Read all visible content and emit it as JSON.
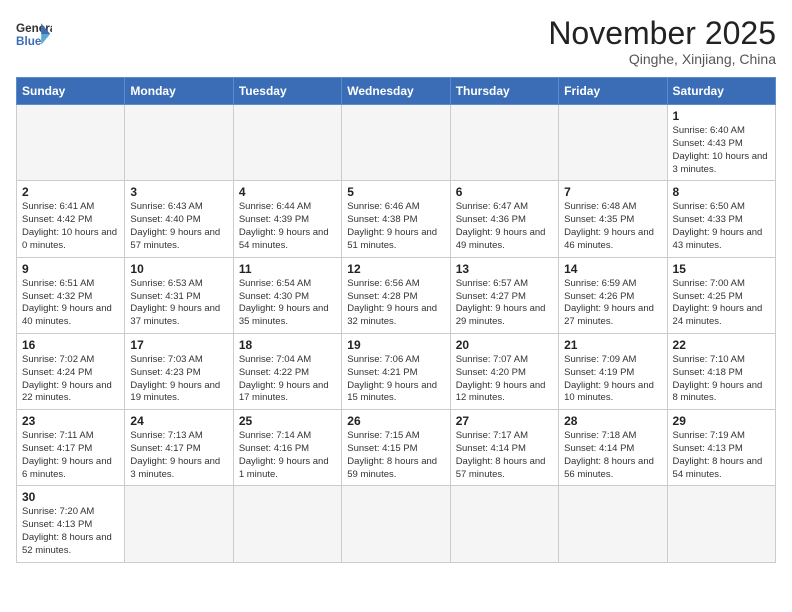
{
  "header": {
    "logo_general": "General",
    "logo_blue": "Blue",
    "title": "November 2025",
    "subtitle": "Qinghe, Xinjiang, China"
  },
  "days_of_week": [
    "Sunday",
    "Monday",
    "Tuesday",
    "Wednesday",
    "Thursday",
    "Friday",
    "Saturday"
  ],
  "weeks": [
    [
      {
        "day": "",
        "info": "",
        "empty": true
      },
      {
        "day": "",
        "info": "",
        "empty": true
      },
      {
        "day": "",
        "info": "",
        "empty": true
      },
      {
        "day": "",
        "info": "",
        "empty": true
      },
      {
        "day": "",
        "info": "",
        "empty": true
      },
      {
        "day": "",
        "info": "",
        "empty": true
      },
      {
        "day": "1",
        "info": "Sunrise: 6:40 AM\nSunset: 4:43 PM\nDaylight: 10 hours\nand 3 minutes."
      }
    ],
    [
      {
        "day": "2",
        "info": "Sunrise: 6:41 AM\nSunset: 4:42 PM\nDaylight: 10 hours\nand 0 minutes."
      },
      {
        "day": "3",
        "info": "Sunrise: 6:43 AM\nSunset: 4:40 PM\nDaylight: 9 hours\nand 57 minutes."
      },
      {
        "day": "4",
        "info": "Sunrise: 6:44 AM\nSunset: 4:39 PM\nDaylight: 9 hours\nand 54 minutes."
      },
      {
        "day": "5",
        "info": "Sunrise: 6:46 AM\nSunset: 4:38 PM\nDaylight: 9 hours\nand 51 minutes."
      },
      {
        "day": "6",
        "info": "Sunrise: 6:47 AM\nSunset: 4:36 PM\nDaylight: 9 hours\nand 49 minutes."
      },
      {
        "day": "7",
        "info": "Sunrise: 6:48 AM\nSunset: 4:35 PM\nDaylight: 9 hours\nand 46 minutes."
      },
      {
        "day": "8",
        "info": "Sunrise: 6:50 AM\nSunset: 4:33 PM\nDaylight: 9 hours\nand 43 minutes."
      }
    ],
    [
      {
        "day": "9",
        "info": "Sunrise: 6:51 AM\nSunset: 4:32 PM\nDaylight: 9 hours\nand 40 minutes."
      },
      {
        "day": "10",
        "info": "Sunrise: 6:53 AM\nSunset: 4:31 PM\nDaylight: 9 hours\nand 37 minutes."
      },
      {
        "day": "11",
        "info": "Sunrise: 6:54 AM\nSunset: 4:30 PM\nDaylight: 9 hours\nand 35 minutes."
      },
      {
        "day": "12",
        "info": "Sunrise: 6:56 AM\nSunset: 4:28 PM\nDaylight: 9 hours\nand 32 minutes."
      },
      {
        "day": "13",
        "info": "Sunrise: 6:57 AM\nSunset: 4:27 PM\nDaylight: 9 hours\nand 29 minutes."
      },
      {
        "day": "14",
        "info": "Sunrise: 6:59 AM\nSunset: 4:26 PM\nDaylight: 9 hours\nand 27 minutes."
      },
      {
        "day": "15",
        "info": "Sunrise: 7:00 AM\nSunset: 4:25 PM\nDaylight: 9 hours\nand 24 minutes."
      }
    ],
    [
      {
        "day": "16",
        "info": "Sunrise: 7:02 AM\nSunset: 4:24 PM\nDaylight: 9 hours\nand 22 minutes."
      },
      {
        "day": "17",
        "info": "Sunrise: 7:03 AM\nSunset: 4:23 PM\nDaylight: 9 hours\nand 19 minutes."
      },
      {
        "day": "18",
        "info": "Sunrise: 7:04 AM\nSunset: 4:22 PM\nDaylight: 9 hours\nand 17 minutes."
      },
      {
        "day": "19",
        "info": "Sunrise: 7:06 AM\nSunset: 4:21 PM\nDaylight: 9 hours\nand 15 minutes."
      },
      {
        "day": "20",
        "info": "Sunrise: 7:07 AM\nSunset: 4:20 PM\nDaylight: 9 hours\nand 12 minutes."
      },
      {
        "day": "21",
        "info": "Sunrise: 7:09 AM\nSunset: 4:19 PM\nDaylight: 9 hours\nand 10 minutes."
      },
      {
        "day": "22",
        "info": "Sunrise: 7:10 AM\nSunset: 4:18 PM\nDaylight: 9 hours\nand 8 minutes."
      }
    ],
    [
      {
        "day": "23",
        "info": "Sunrise: 7:11 AM\nSunset: 4:17 PM\nDaylight: 9 hours\nand 6 minutes."
      },
      {
        "day": "24",
        "info": "Sunrise: 7:13 AM\nSunset: 4:17 PM\nDaylight: 9 hours\nand 3 minutes."
      },
      {
        "day": "25",
        "info": "Sunrise: 7:14 AM\nSunset: 4:16 PM\nDaylight: 9 hours\nand 1 minute."
      },
      {
        "day": "26",
        "info": "Sunrise: 7:15 AM\nSunset: 4:15 PM\nDaylight: 8 hours\nand 59 minutes."
      },
      {
        "day": "27",
        "info": "Sunrise: 7:17 AM\nSunset: 4:14 PM\nDaylight: 8 hours\nand 57 minutes."
      },
      {
        "day": "28",
        "info": "Sunrise: 7:18 AM\nSunset: 4:14 PM\nDaylight: 8 hours\nand 56 minutes."
      },
      {
        "day": "29",
        "info": "Sunrise: 7:19 AM\nSunset: 4:13 PM\nDaylight: 8 hours\nand 54 minutes."
      }
    ],
    [
      {
        "day": "30",
        "info": "Sunrise: 7:20 AM\nSunset: 4:13 PM\nDaylight: 8 hours\nand 52 minutes."
      },
      {
        "day": "",
        "info": "",
        "empty": true
      },
      {
        "day": "",
        "info": "",
        "empty": true
      },
      {
        "day": "",
        "info": "",
        "empty": true
      },
      {
        "day": "",
        "info": "",
        "empty": true
      },
      {
        "day": "",
        "info": "",
        "empty": true
      },
      {
        "day": "",
        "info": "",
        "empty": true
      }
    ]
  ]
}
